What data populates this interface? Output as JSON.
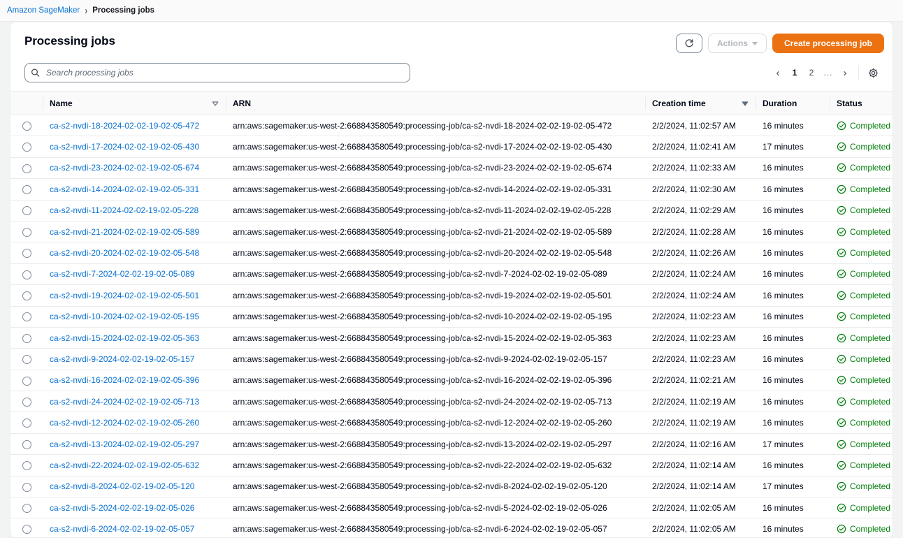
{
  "breadcrumb": {
    "root": "Amazon SageMaker",
    "separator": "›",
    "current": "Processing jobs"
  },
  "header": {
    "title": "Processing jobs",
    "refresh_icon": "refresh-icon",
    "actions_label": "Actions",
    "create_label": "Create processing job"
  },
  "search": {
    "placeholder": "Search processing jobs",
    "value": "",
    "icon": "search-icon"
  },
  "pagination": {
    "prev": "‹",
    "pages": [
      "1",
      "2"
    ],
    "ellipsis": "...",
    "next": "›",
    "current_page": "1",
    "settings_icon": "gear-icon"
  },
  "colors": {
    "accent_orange": "#ec7211",
    "link_blue": "#0972d3",
    "status_green": "#037f0c",
    "border": "#e9ebed"
  },
  "table": {
    "columns": [
      {
        "key": "select",
        "label": ""
      },
      {
        "key": "name",
        "label": "Name",
        "sortable": true,
        "sorted": false
      },
      {
        "key": "arn",
        "label": "ARN",
        "sortable": false
      },
      {
        "key": "creation_time",
        "label": "Creation time",
        "sortable": true,
        "sorted": true
      },
      {
        "key": "duration",
        "label": "Duration",
        "sortable": false
      },
      {
        "key": "status",
        "label": "Status",
        "sortable": true,
        "sorted": false
      }
    ],
    "arn_prefix": "arn:aws:sagemaker:us-west-2:668843580549:processing-job/",
    "rows": [
      {
        "name": "ca-s2-nvdi-18-2024-02-02-19-02-05-472",
        "arn": "arn:aws:sagemaker:us-west-2:668843580549:processing-job/ca-s2-nvdi-18-2024-02-02-19-02-05-472",
        "creation_time": "2/2/2024, 11:02:57 AM",
        "duration": "16 minutes",
        "status": "Completed"
      },
      {
        "name": "ca-s2-nvdi-17-2024-02-02-19-02-05-430",
        "arn": "arn:aws:sagemaker:us-west-2:668843580549:processing-job/ca-s2-nvdi-17-2024-02-02-19-02-05-430",
        "creation_time": "2/2/2024, 11:02:41 AM",
        "duration": "17 minutes",
        "status": "Completed"
      },
      {
        "name": "ca-s2-nvdi-23-2024-02-02-19-02-05-674",
        "arn": "arn:aws:sagemaker:us-west-2:668843580549:processing-job/ca-s2-nvdi-23-2024-02-02-19-02-05-674",
        "creation_time": "2/2/2024, 11:02:33 AM",
        "duration": "16 minutes",
        "status": "Completed"
      },
      {
        "name": "ca-s2-nvdi-14-2024-02-02-19-02-05-331",
        "arn": "arn:aws:sagemaker:us-west-2:668843580549:processing-job/ca-s2-nvdi-14-2024-02-02-19-02-05-331",
        "creation_time": "2/2/2024, 11:02:30 AM",
        "duration": "16 minutes",
        "status": "Completed"
      },
      {
        "name": "ca-s2-nvdi-11-2024-02-02-19-02-05-228",
        "arn": "arn:aws:sagemaker:us-west-2:668843580549:processing-job/ca-s2-nvdi-11-2024-02-02-19-02-05-228",
        "creation_time": "2/2/2024, 11:02:29 AM",
        "duration": "16 minutes",
        "status": "Completed"
      },
      {
        "name": "ca-s2-nvdi-21-2024-02-02-19-02-05-589",
        "arn": "arn:aws:sagemaker:us-west-2:668843580549:processing-job/ca-s2-nvdi-21-2024-02-02-19-02-05-589",
        "creation_time": "2/2/2024, 11:02:28 AM",
        "duration": "16 minutes",
        "status": "Completed"
      },
      {
        "name": "ca-s2-nvdi-20-2024-02-02-19-02-05-548",
        "arn": "arn:aws:sagemaker:us-west-2:668843580549:processing-job/ca-s2-nvdi-20-2024-02-02-19-02-05-548",
        "creation_time": "2/2/2024, 11:02:26 AM",
        "duration": "16 minutes",
        "status": "Completed"
      },
      {
        "name": "ca-s2-nvdi-7-2024-02-02-19-02-05-089",
        "arn": "arn:aws:sagemaker:us-west-2:668843580549:processing-job/ca-s2-nvdi-7-2024-02-02-19-02-05-089",
        "creation_time": "2/2/2024, 11:02:24 AM",
        "duration": "16 minutes",
        "status": "Completed"
      },
      {
        "name": "ca-s2-nvdi-19-2024-02-02-19-02-05-501",
        "arn": "arn:aws:sagemaker:us-west-2:668843580549:processing-job/ca-s2-nvdi-19-2024-02-02-19-02-05-501",
        "creation_time": "2/2/2024, 11:02:24 AM",
        "duration": "16 minutes",
        "status": "Completed"
      },
      {
        "name": "ca-s2-nvdi-10-2024-02-02-19-02-05-195",
        "arn": "arn:aws:sagemaker:us-west-2:668843580549:processing-job/ca-s2-nvdi-10-2024-02-02-19-02-05-195",
        "creation_time": "2/2/2024, 11:02:23 AM",
        "duration": "16 minutes",
        "status": "Completed"
      },
      {
        "name": "ca-s2-nvdi-15-2024-02-02-19-02-05-363",
        "arn": "arn:aws:sagemaker:us-west-2:668843580549:processing-job/ca-s2-nvdi-15-2024-02-02-19-02-05-363",
        "creation_time": "2/2/2024, 11:02:23 AM",
        "duration": "16 minutes",
        "status": "Completed"
      },
      {
        "name": "ca-s2-nvdi-9-2024-02-02-19-02-05-157",
        "arn": "arn:aws:sagemaker:us-west-2:668843580549:processing-job/ca-s2-nvdi-9-2024-02-02-19-02-05-157",
        "creation_time": "2/2/2024, 11:02:23 AM",
        "duration": "16 minutes",
        "status": "Completed"
      },
      {
        "name": "ca-s2-nvdi-16-2024-02-02-19-02-05-396",
        "arn": "arn:aws:sagemaker:us-west-2:668843580549:processing-job/ca-s2-nvdi-16-2024-02-02-19-02-05-396",
        "creation_time": "2/2/2024, 11:02:21 AM",
        "duration": "16 minutes",
        "status": "Completed"
      },
      {
        "name": "ca-s2-nvdi-24-2024-02-02-19-02-05-713",
        "arn": "arn:aws:sagemaker:us-west-2:668843580549:processing-job/ca-s2-nvdi-24-2024-02-02-19-02-05-713",
        "creation_time": "2/2/2024, 11:02:19 AM",
        "duration": "16 minutes",
        "status": "Completed"
      },
      {
        "name": "ca-s2-nvdi-12-2024-02-02-19-02-05-260",
        "arn": "arn:aws:sagemaker:us-west-2:668843580549:processing-job/ca-s2-nvdi-12-2024-02-02-19-02-05-260",
        "creation_time": "2/2/2024, 11:02:19 AM",
        "duration": "16 minutes",
        "status": "Completed"
      },
      {
        "name": "ca-s2-nvdi-13-2024-02-02-19-02-05-297",
        "arn": "arn:aws:sagemaker:us-west-2:668843580549:processing-job/ca-s2-nvdi-13-2024-02-02-19-02-05-297",
        "creation_time": "2/2/2024, 11:02:16 AM",
        "duration": "17 minutes",
        "status": "Completed"
      },
      {
        "name": "ca-s2-nvdi-22-2024-02-02-19-02-05-632",
        "arn": "arn:aws:sagemaker:us-west-2:668843580549:processing-job/ca-s2-nvdi-22-2024-02-02-19-02-05-632",
        "creation_time": "2/2/2024, 11:02:14 AM",
        "duration": "16 minutes",
        "status": "Completed"
      },
      {
        "name": "ca-s2-nvdi-8-2024-02-02-19-02-05-120",
        "arn": "arn:aws:sagemaker:us-west-2:668843580549:processing-job/ca-s2-nvdi-8-2024-02-02-19-02-05-120",
        "creation_time": "2/2/2024, 11:02:14 AM",
        "duration": "17 minutes",
        "status": "Completed"
      },
      {
        "name": "ca-s2-nvdi-5-2024-02-02-19-02-05-026",
        "arn": "arn:aws:sagemaker:us-west-2:668843580549:processing-job/ca-s2-nvdi-5-2024-02-02-19-02-05-026",
        "creation_time": "2/2/2024, 11:02:05 AM",
        "duration": "16 minutes",
        "status": "Completed"
      },
      {
        "name": "ca-s2-nvdi-6-2024-02-02-19-02-05-057",
        "arn": "arn:aws:sagemaker:us-west-2:668843580549:processing-job/ca-s2-nvdi-6-2024-02-02-19-02-05-057",
        "creation_time": "2/2/2024, 11:02:05 AM",
        "duration": "16 minutes",
        "status": "Completed"
      }
    ]
  }
}
